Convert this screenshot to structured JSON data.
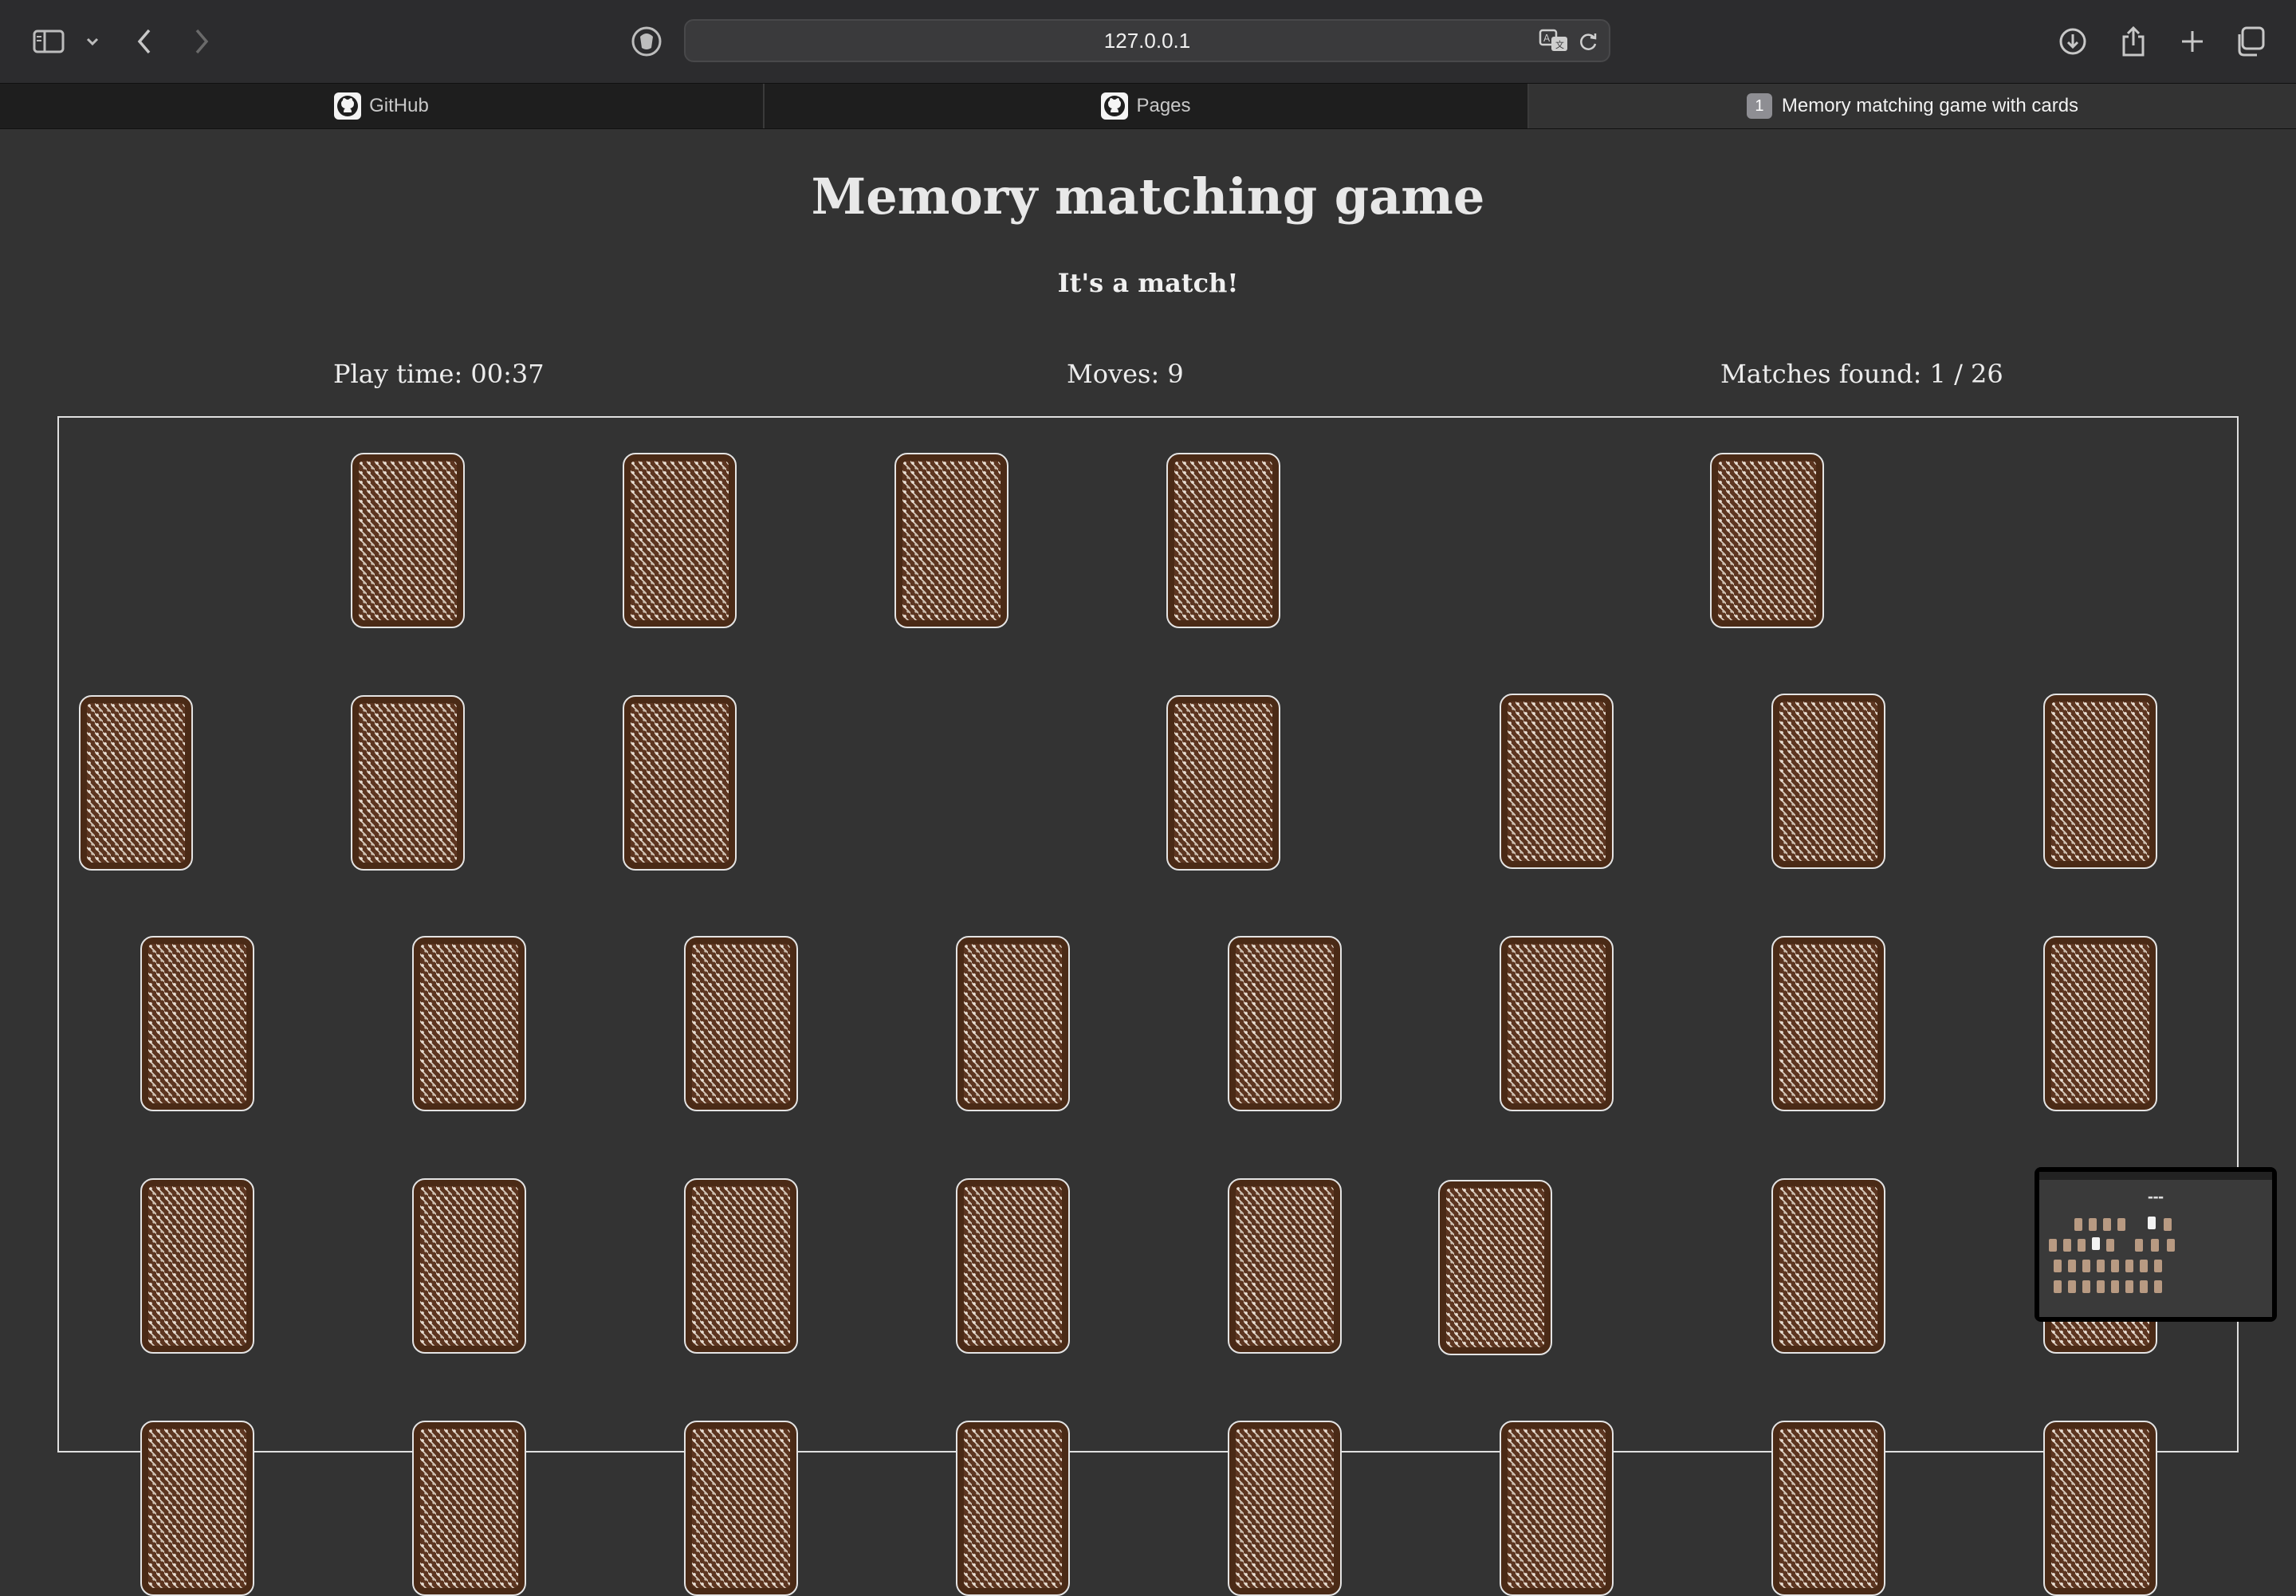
{
  "browser": {
    "url": "127.0.0.1",
    "tabs": [
      {
        "label": "GitHub",
        "icon": "github-icon",
        "active": false
      },
      {
        "label": "Pages",
        "icon": "github-icon",
        "active": false
      },
      {
        "label": "Memory matching game with cards",
        "badge": "1",
        "active": true
      }
    ],
    "icons": [
      "sidebar-icon",
      "chevron-down-icon",
      "back-icon",
      "forward-icon",
      "privacy-icon",
      "translate-icon",
      "reload-icon",
      "download-icon",
      "share-icon",
      "new-tab-icon",
      "tab-overview-icon"
    ]
  },
  "game": {
    "title": "Memory matching game",
    "status": "It's a match!",
    "play_time": "Play time: 00:37",
    "moves": "Moves: 9",
    "matches": "Matches found: 1 / 26",
    "card_back_colors": {
      "border": "#e4e4e4",
      "fill": "#4a2a16",
      "pattern": "#d9ccbe"
    }
  }
}
